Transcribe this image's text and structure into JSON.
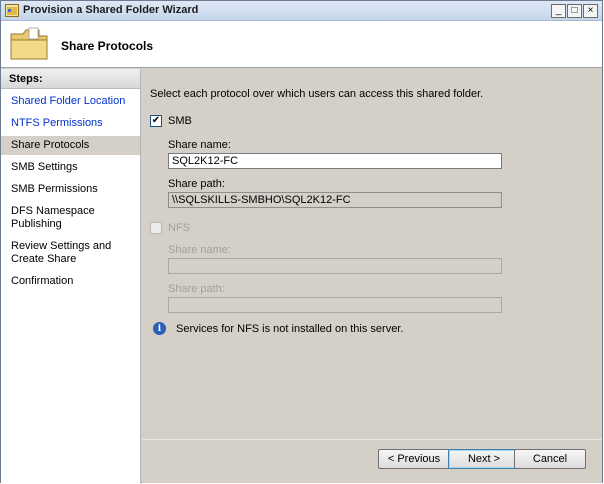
{
  "window": {
    "title": "Provision a Shared Folder Wizard",
    "controls": {
      "minimize": "_",
      "maximize": "□",
      "close": "×"
    }
  },
  "header": {
    "title": "Share Protocols",
    "icon": "folder-icon"
  },
  "steps": {
    "heading": "Steps:",
    "items": [
      {
        "label": "Shared Folder Location",
        "state": "link"
      },
      {
        "label": "NTFS Permissions",
        "state": "link"
      },
      {
        "label": "Share Protocols",
        "state": "current"
      },
      {
        "label": "SMB Settings",
        "state": "normal"
      },
      {
        "label": "SMB Permissions",
        "state": "normal"
      },
      {
        "label": "DFS Namespace Publishing",
        "state": "normal"
      },
      {
        "label": "Review Settings and Create Share",
        "state": "normal"
      },
      {
        "label": "Confirmation",
        "state": "normal"
      }
    ]
  },
  "main": {
    "instruction": "Select each protocol over which users can access this shared folder.",
    "smb": {
      "label": "SMB",
      "checked": true,
      "share_name_label": "Share name:",
      "share_name_value": "SQL2K12-FC",
      "share_path_label": "Share path:",
      "share_path_value": "\\\\SQLSKILLS-SMBHO\\SQL2K12-FC"
    },
    "nfs": {
      "label": "NFS",
      "checked": false,
      "share_name_label": "Share name:",
      "share_name_value": "",
      "share_path_label": "Share path:",
      "share_path_value": ""
    },
    "info": "Services for NFS is not installed on this server."
  },
  "footer": {
    "previous": "< Previous",
    "next": "Next >",
    "cancel": "Cancel"
  }
}
